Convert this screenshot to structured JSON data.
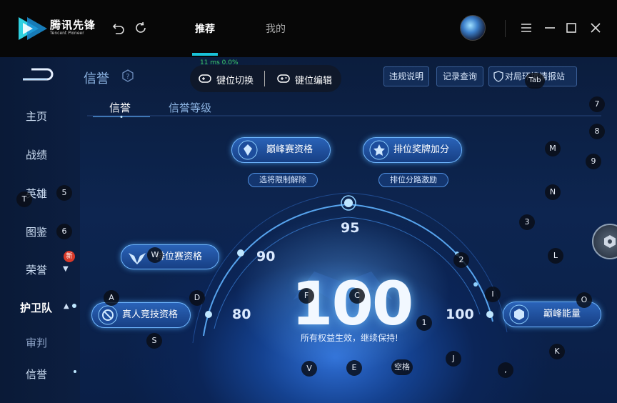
{
  "titlebar": {
    "brand_cn": "腾讯先锋",
    "brand_en": "Tencent Pioneer",
    "tabs": [
      "推荐",
      "我的"
    ],
    "icons": [
      "back-arrow-icon",
      "refresh-icon",
      "menu-icon",
      "minimize-icon",
      "maximize-icon",
      "close-icon"
    ]
  },
  "header": {
    "title": "信誉",
    "buttons": [
      "违规说明",
      "记录查询",
      "对局环境情报站"
    ],
    "keyhint": {
      "switch": "键位切换",
      "edit": "键位编辑",
      "overlay": "Tab",
      "status": "11 ms  0.0%"
    }
  },
  "sidebar": {
    "items": [
      "主页",
      "战绩",
      "英雄",
      "图鉴",
      "荣誉",
      "护卫队",
      "审判",
      "信誉"
    ],
    "new_badge": "新"
  },
  "subtabs": [
    "信誉",
    "信誉等级"
  ],
  "privileges": {
    "peak": "巅峰赛资格",
    "rank_medal": "排位奖牌加分",
    "peak_sub": "选将限制解除",
    "rank_sub": "排位分路激励",
    "ranked": "排位赛资格",
    "real_person": "真人竞技资格",
    "peak_energy": "巅峰能量"
  },
  "score": {
    "value": "100",
    "desc": "所有权益生效，继续保持!",
    "marks": [
      "80",
      "90",
      "95",
      "100"
    ]
  },
  "keys": [
    "T",
    "5",
    "6",
    "W",
    "A",
    "D",
    "S",
    "F",
    "C",
    "V",
    "E",
    "空格",
    "1",
    "J",
    "2",
    "I",
    "3",
    "L",
    "N",
    "M",
    "9",
    "8",
    "7",
    "O",
    "K",
    ","
  ],
  "colors": {
    "accent": "#19c2d8",
    "badge": "#d93a2a",
    "glow": "#6fb6ff"
  }
}
